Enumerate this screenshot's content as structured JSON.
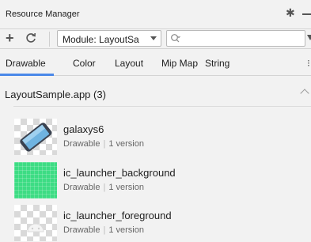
{
  "window": {
    "title": "Resource Manager",
    "settings_icon": "gear-icon",
    "minimize_icon": "minimize-icon"
  },
  "toolbar": {
    "add_icon": "plus-icon",
    "refresh_icon": "refresh-icon",
    "module_label": "Module: LayoutSa",
    "search_value": "",
    "search_placeholder": "",
    "filter_icon": "filter-icon"
  },
  "tabs": [
    {
      "label": "Drawable",
      "active": true
    },
    {
      "label": "Color",
      "active": false
    },
    {
      "label": "Layout",
      "active": false
    },
    {
      "label": "Mip Map",
      "active": false
    },
    {
      "label": "String",
      "active": false
    }
  ],
  "section": {
    "title": "LayoutSample.app (3)"
  },
  "resources": [
    {
      "name": "galaxys6",
      "type": "Drawable",
      "versions": "1 version",
      "thumbnail": "phone-image"
    },
    {
      "name": "ic_launcher_background",
      "type": "Drawable",
      "versions": "1 version",
      "thumbnail": "green-grid-image"
    },
    {
      "name": "ic_launcher_foreground",
      "type": "Drawable",
      "versions": "1 version",
      "thumbnail": "android-head-image"
    }
  ],
  "colors": {
    "accent": "#4a88e8",
    "launcher_green": "#3ddc84",
    "background": "#f2f2f2"
  }
}
